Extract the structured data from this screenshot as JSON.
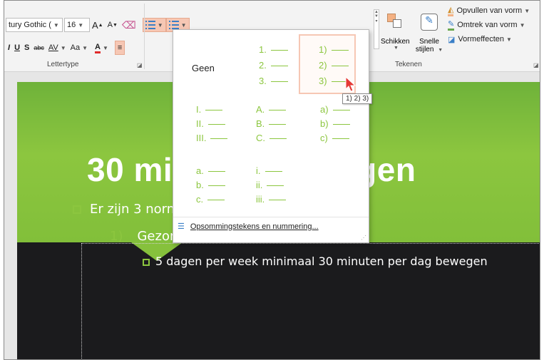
{
  "ribbon": {
    "font_name": "tury Gothic (",
    "font_size": "16",
    "grow_font": "A",
    "shrink_font": "A",
    "underline": "U",
    "strike": "S",
    "abc": "abc",
    "spacing": "AV",
    "case": "Aa",
    "font_color": "A",
    "italic": "I",
    "group_lettertype": "Lettertype",
    "group_tekenen": "Tekenen",
    "schikken": "Schikken",
    "snelle": "Snelle",
    "stijlen": "stijlen",
    "opvullen": "Opvullen van vorm",
    "omtrek": "Omtrek van vorm",
    "vormeffecten": "Vormeffecten"
  },
  "gallery": {
    "none_label": "Geen",
    "cells": [
      {
        "lines": [
          "1.",
          "2.",
          "3."
        ]
      },
      {
        "lines": [
          "1)",
          "2)",
          "3)"
        ]
      },
      {
        "lines": [
          "I.",
          "II.",
          "III."
        ]
      },
      {
        "lines": [
          "A.",
          "B.",
          "C."
        ]
      },
      {
        "lines": [
          "a)",
          "b)",
          "c)"
        ]
      },
      {
        "lines": [
          "a.",
          "b.",
          "c."
        ]
      },
      {
        "lines": [
          "i.",
          "ii.",
          "iii."
        ]
      }
    ],
    "footer_label": "Opsommingstekens en nummering..."
  },
  "tooltip": "1) 2) 3)",
  "slide": {
    "title": "30 minuten bewegen",
    "bullet1": "Er zijn 3 normen:",
    "item_number": "1)",
    "item_text": "Gezond  bewegen",
    "sub_bullet": "5 dagen per week minimaal 30 minuten per dag bewegen"
  },
  "colors": {
    "accent_green": "#8cc63f",
    "active_button": "#f6c7b4",
    "slide_dark": "#1b1b1d"
  }
}
